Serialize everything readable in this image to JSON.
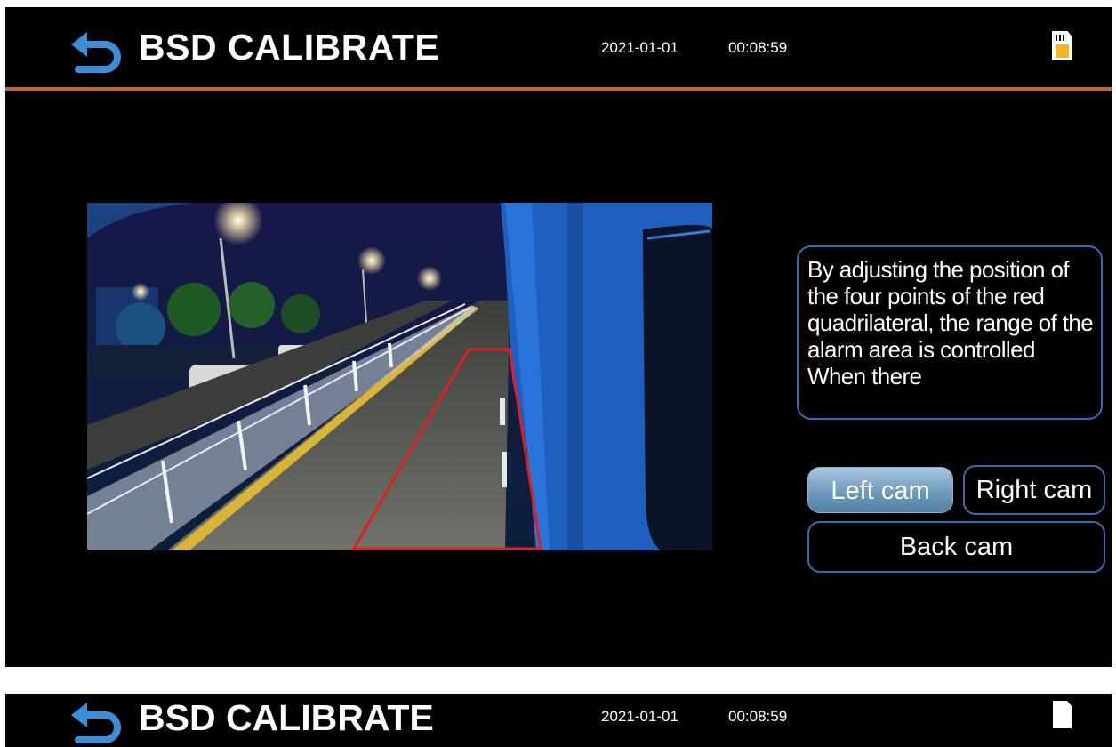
{
  "header": {
    "title": "BSD CALIBRATE",
    "date": "2021-01-01",
    "time": "00:08:59"
  },
  "icons": {
    "back": "back-arrow-icon",
    "sd_card": "sd-card-icon"
  },
  "info_text": "By adjusting the position of the four points of the red quadrilateral, the range of the alarm area is controlled When there",
  "buttons": {
    "left_cam": "Left cam",
    "right_cam": "Right cam",
    "back_cam": "Back cam"
  },
  "second_screen": {
    "title": "BSD CALIBRATE",
    "date": "2021-01-01",
    "time": "00:08:59"
  },
  "colors": {
    "accent_line": "#c0692f",
    "button_border": "#2e6fb8",
    "selected_button": "#6f9abd",
    "back_icon": "#3a8fd6",
    "calibration_zone": "#e02020"
  }
}
